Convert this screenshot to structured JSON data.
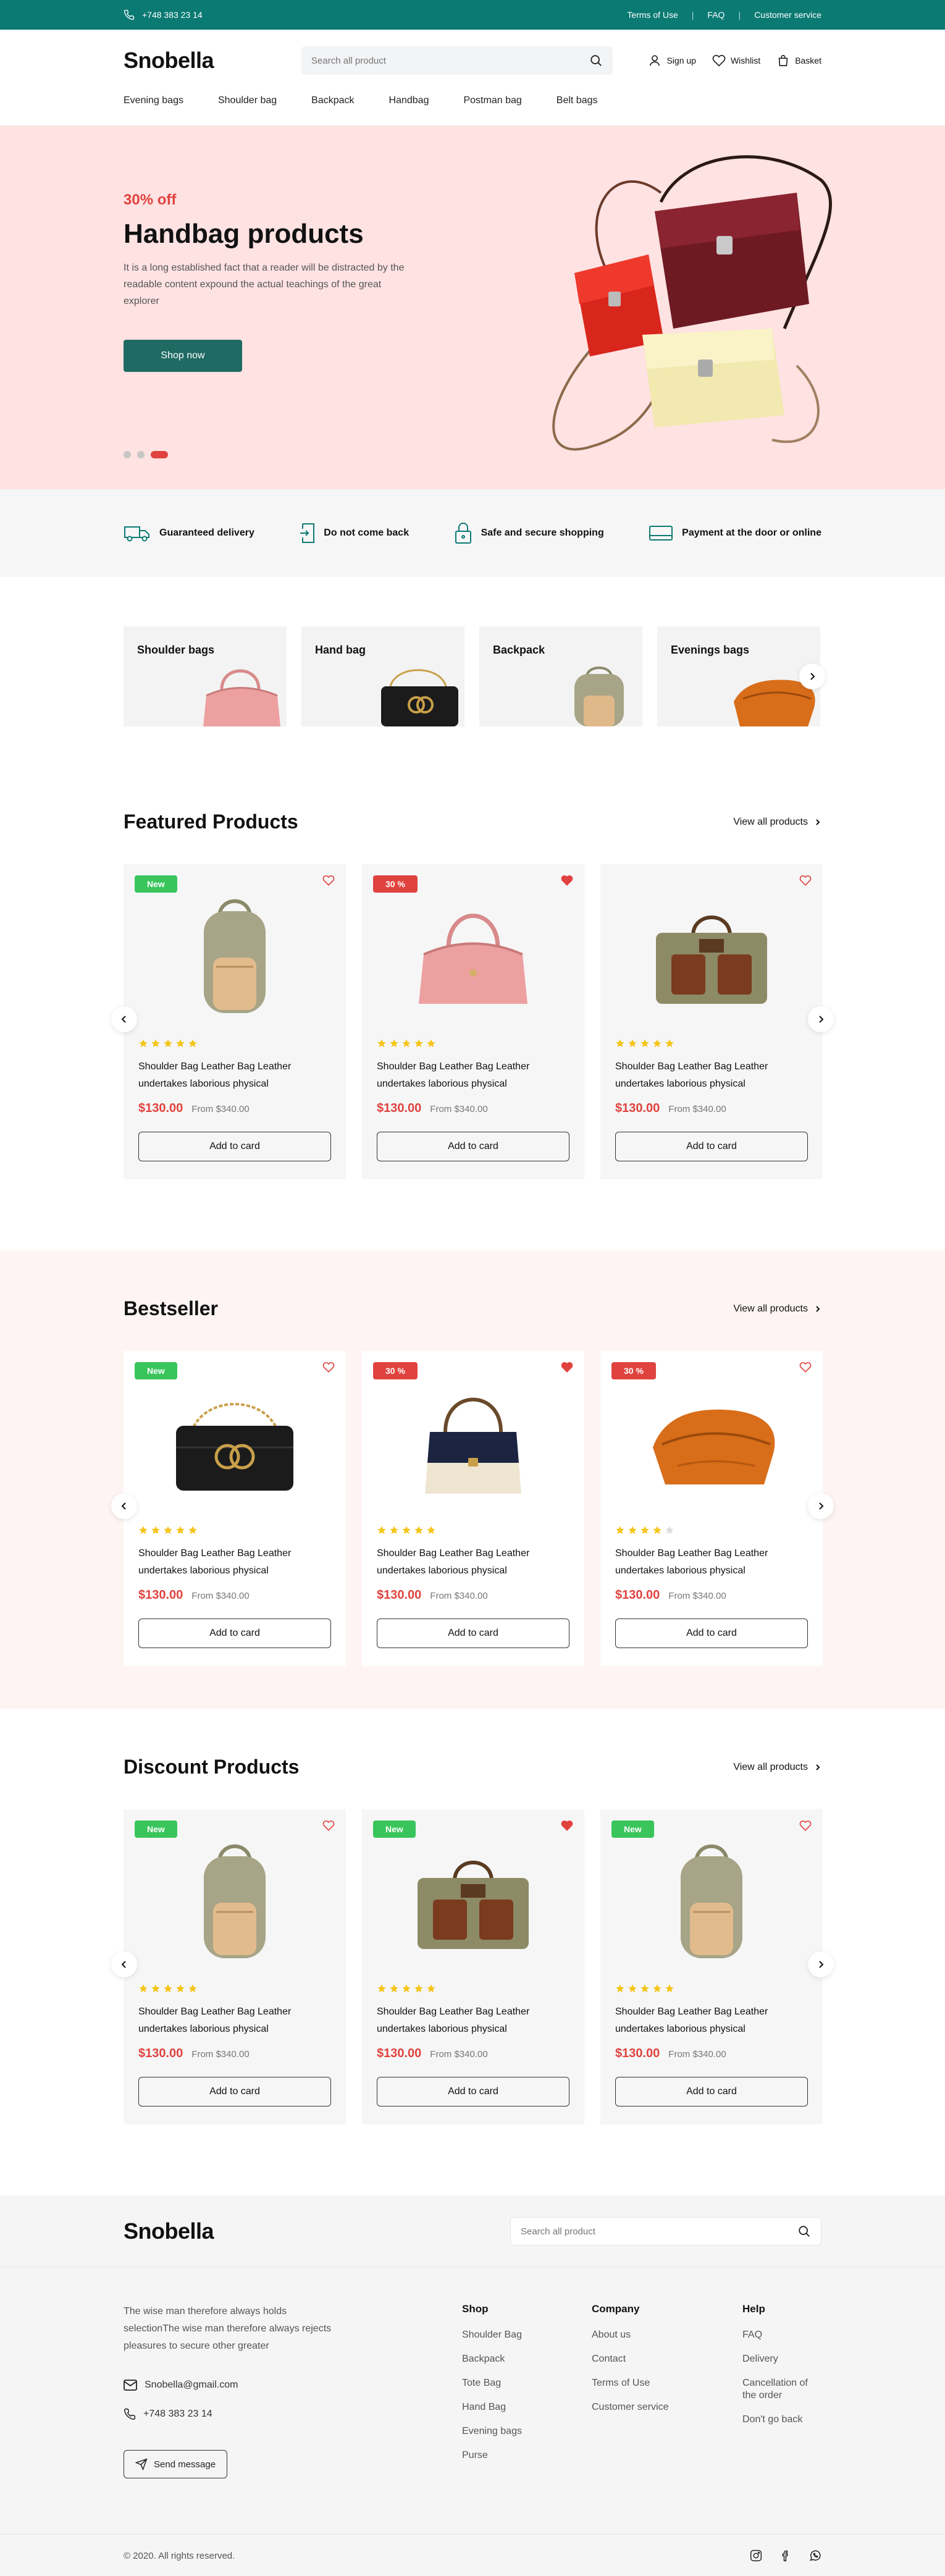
{
  "topbar": {
    "phone": "+748 383 23 14",
    "links": [
      "Terms of Use",
      "FAQ",
      "Customer service"
    ],
    "separator": "|"
  },
  "header": {
    "logo": "Snobella",
    "search_placeholder": "Search all product",
    "actions": [
      "Sign up",
      "Wishlist",
      "Basket"
    ],
    "nav": [
      "Evening bags",
      "Shoulder bag",
      "Backpack",
      "Handbag",
      "Postman bag",
      "Belt bags"
    ]
  },
  "hero": {
    "discount": "30% off",
    "title": "Handbag products",
    "text": "It is a long established fact that a reader will be distracted by the readable content expound the actual teachings of the great explorer",
    "button": "Shop now"
  },
  "features": [
    "Guaranteed delivery",
    "Do not come back",
    "Safe and secure shopping",
    "Payment at the door or online"
  ],
  "categories": [
    "Shoulder  bags",
    "Hand bag",
    "Backpack",
    "Evenings bags"
  ],
  "sections": [
    {
      "title": "Featured Products",
      "view_all": "View all products",
      "products": [
        {
          "badge": "New",
          "badge_type": "new",
          "liked": false,
          "image": "backpack",
          "rating": 5,
          "name": "Shoulder Bag Leather Bag Leather undertakes laborious physical",
          "price": "$130.00",
          "old_price": "From $340.00",
          "button": "Add to card"
        },
        {
          "badge": "30 %",
          "badge_type": "sale",
          "liked": true,
          "image": "pink-handbag",
          "rating": 5,
          "name": "Shoulder Bag Leather Bag Leather undertakes laborious physical",
          "price": "$130.00",
          "old_price": "From $340.00",
          "button": "Add to card"
        },
        {
          "badge": "",
          "badge_type": "",
          "liked": false,
          "image": "messenger",
          "rating": 5,
          "name": "Shoulder Bag Leather Bag Leather undertakes laborious physical",
          "price": "$130.00",
          "old_price": "From $340.00",
          "button": "Add to card"
        }
      ]
    },
    {
      "title": "Bestseller",
      "view_all": "View all products",
      "products": [
        {
          "badge": "New",
          "badge_type": "new",
          "liked": false,
          "image": "black-chain",
          "rating": 5,
          "name": "Shoulder Bag Leather Bag Leather undertakes laborious physical",
          "price": "$130.00",
          "old_price": "From $340.00",
          "button": "Add to card"
        },
        {
          "badge": "30 %",
          "badge_type": "sale",
          "liked": true,
          "image": "navy-bag",
          "rating": 5,
          "name": "Shoulder Bag Leather Bag Leather undertakes laborious physical",
          "price": "$130.00",
          "old_price": "From $340.00",
          "button": "Add to card"
        },
        {
          "badge": "30 %",
          "badge_type": "sale",
          "liked": false,
          "image": "orange-clutch",
          "rating": 4,
          "name": "Shoulder Bag Leather Bag Leather undertakes laborious physical",
          "price": "$130.00",
          "old_price": "From $340.00",
          "button": "Add to card"
        }
      ]
    },
    {
      "title": "Discount Products",
      "view_all": "View all products",
      "products": [
        {
          "badge": "New",
          "badge_type": "new",
          "liked": false,
          "image": "backpack",
          "rating": 5,
          "name": "Shoulder Bag Leather Bag Leather undertakes laborious physical",
          "price": "$130.00",
          "old_price": "From $340.00",
          "button": "Add to card"
        },
        {
          "badge": "New",
          "badge_type": "new",
          "liked": true,
          "image": "messenger",
          "rating": 5,
          "name": "Shoulder Bag Leather Bag Leather undertakes laborious physical",
          "price": "$130.00",
          "old_price": "From $340.00",
          "button": "Add to card"
        },
        {
          "badge": "New",
          "badge_type": "new",
          "liked": false,
          "image": "backpack",
          "rating": 5,
          "name": "Shoulder Bag Leather Bag Leather undertakes laborious physical",
          "price": "$130.00",
          "old_price": "From $340.00",
          "button": "Add to card"
        }
      ]
    }
  ],
  "footer": {
    "logo": "Snobella",
    "search_placeholder": "Search all product",
    "description": "The wise man therefore always holds selectionThe wise man therefore always rejects pleasures to secure other greater",
    "email": "Snobella@gmail.com",
    "phone": "+748 383 23 14",
    "send_button": "Send message",
    "columns": [
      {
        "title": "Shop",
        "links": [
          "Shoulder Bag",
          "Backpack",
          "Tote Bag",
          "Hand Bag",
          "Evening bags",
          "Purse"
        ]
      },
      {
        "title": "Company",
        "links": [
          "About us",
          "Contact",
          "Terms of Use",
          "Customer service"
        ]
      },
      {
        "title": "Help",
        "links": [
          "FAQ",
          "Delivery",
          "Cancellation of the order",
          "Don't go back"
        ]
      }
    ],
    "copyright": "© 2020. All rights reserved."
  },
  "colors": {
    "teal": "#0b7a73",
    "accent": "#e0433f",
    "new_badge": "#39c55b",
    "star": "#f5c518",
    "hero_bg": "#ffe2e2"
  }
}
